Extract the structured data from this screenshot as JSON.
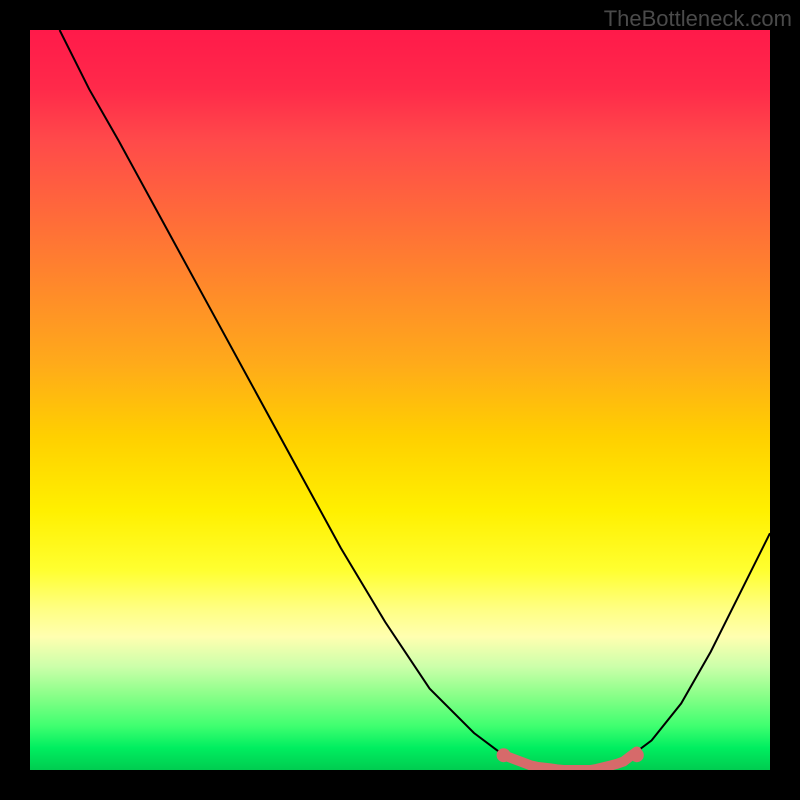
{
  "watermark": "TheBottleneck.com",
  "chart_data": {
    "type": "line",
    "title": "",
    "xlabel": "",
    "ylabel": "",
    "xlim": [
      0,
      100
    ],
    "ylim": [
      0,
      100
    ],
    "grid": false,
    "curve_points": [
      {
        "x": 4,
        "y": 100
      },
      {
        "x": 8,
        "y": 92
      },
      {
        "x": 12,
        "y": 85
      },
      {
        "x": 18,
        "y": 74
      },
      {
        "x": 24,
        "y": 63
      },
      {
        "x": 30,
        "y": 52
      },
      {
        "x": 36,
        "y": 41
      },
      {
        "x": 42,
        "y": 30
      },
      {
        "x": 48,
        "y": 20
      },
      {
        "x": 54,
        "y": 11
      },
      {
        "x": 60,
        "y": 5
      },
      {
        "x": 64,
        "y": 2
      },
      {
        "x": 68,
        "y": 0.5
      },
      {
        "x": 72,
        "y": 0
      },
      {
        "x": 76,
        "y": 0
      },
      {
        "x": 80,
        "y": 1
      },
      {
        "x": 84,
        "y": 4
      },
      {
        "x": 88,
        "y": 9
      },
      {
        "x": 92,
        "y": 16
      },
      {
        "x": 96,
        "y": 24
      },
      {
        "x": 100,
        "y": 32
      }
    ],
    "highlight_range": {
      "x_start": 64,
      "x_end": 82
    },
    "highlight_dots": [
      {
        "x": 64,
        "y": 2
      },
      {
        "x": 82,
        "y": 2
      }
    ],
    "background_gradient": {
      "top": "#ff1a4a",
      "middle": "#ffff30",
      "bottom": "#00cc50"
    }
  }
}
